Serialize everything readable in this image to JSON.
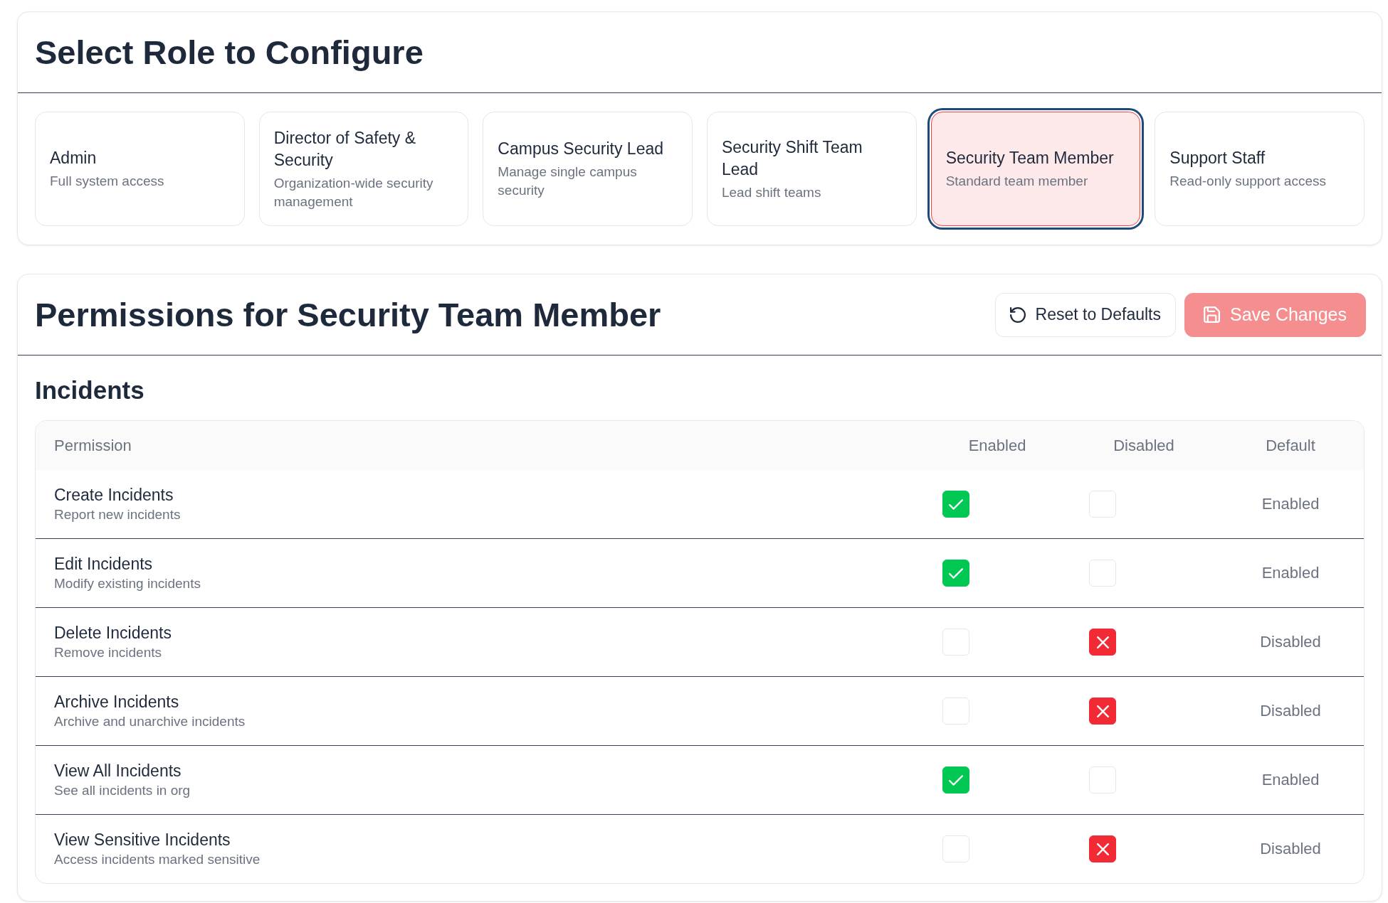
{
  "role_section": {
    "title": "Select Role to Configure",
    "roles": [
      {
        "name": "Admin",
        "description": "Full system access",
        "selected": false
      },
      {
        "name": "Director of Safety & Security",
        "description": "Organization-wide security management",
        "selected": false
      },
      {
        "name": "Campus Security Lead",
        "description": "Manage single campus security",
        "selected": false
      },
      {
        "name": "Security Shift Team Lead",
        "description": "Lead shift teams",
        "selected": false
      },
      {
        "name": "Security Team Member",
        "description": "Standard team member",
        "selected": true
      },
      {
        "name": "Support Staff",
        "description": "Read-only support access",
        "selected": false
      }
    ]
  },
  "permissions_panel": {
    "title": "Permissions for Security Team Member",
    "buttons": [
      {
        "kind": "reset",
        "label": "Reset to Defaults",
        "disabled": false
      },
      {
        "kind": "save",
        "label": "Save Changes",
        "disabled": true
      }
    ],
    "sections": [
      {
        "title": "Incidents",
        "table": {
          "columns": [
            "Permission",
            "Enabled",
            "Disabled",
            "Default"
          ],
          "rows": [
            {
              "name": "Create Incidents",
              "description": "Report new incidents",
              "enabled_box": {
                "checked": true
              },
              "disabled_box": {
                "checked": false
              },
              "default": "Enabled"
            },
            {
              "name": "Edit Incidents",
              "description": "Modify existing incidents",
              "enabled_box": {
                "checked": true
              },
              "disabled_box": {
                "checked": false
              },
              "default": "Enabled"
            },
            {
              "name": "Delete Incidents",
              "description": "Remove incidents",
              "enabled_box": {
                "checked": false
              },
              "disabled_box": {
                "checked": true
              },
              "default": "Disabled"
            },
            {
              "name": "Archive Incidents",
              "description": "Archive and unarchive incidents",
              "enabled_box": {
                "checked": false
              },
              "disabled_box": {
                "checked": true
              },
              "default": "Disabled"
            },
            {
              "name": "View All Incidents",
              "description": "See all incidents in org",
              "enabled_box": {
                "checked": true
              },
              "disabled_box": {
                "checked": false
              },
              "default": "Enabled"
            },
            {
              "name": "View Sensitive Incidents",
              "description": "Access incidents marked sensitive",
              "enabled_box": {
                "checked": false
              },
              "disabled_box": {
                "checked": true
              },
              "default": "Disabled"
            }
          ]
        }
      }
    ]
  }
}
